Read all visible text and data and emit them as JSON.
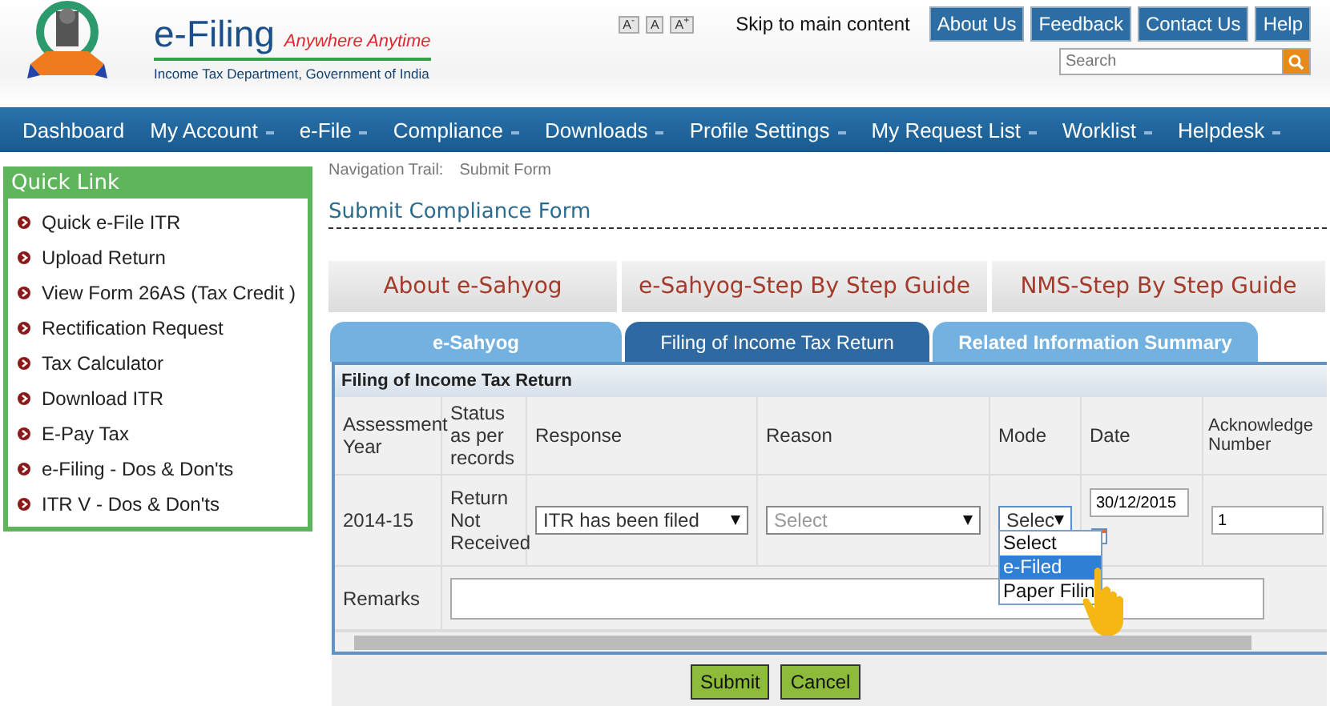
{
  "header": {
    "site_title": "e-Filing",
    "tagline": "Anywhere Anytime",
    "department": "Income Tax Department, Government of India",
    "font_size_buttons": [
      "A$^{-}$",
      "A",
      "A$^{+}$"
    ],
    "skip_link": "Skip to main content",
    "top_links": [
      "About Us",
      "Feedback",
      "Contact Us",
      "Help"
    ],
    "search": {
      "placeholder": "Search"
    }
  },
  "nav": [
    {
      "label": "Dashboard",
      "dropdown": false
    },
    {
      "label": "My Account",
      "dropdown": true
    },
    {
      "label": "e-File",
      "dropdown": true
    },
    {
      "label": "Compliance",
      "dropdown": true
    },
    {
      "label": "Downloads",
      "dropdown": true
    },
    {
      "label": "Profile Settings",
      "dropdown": true
    },
    {
      "label": "My Request List",
      "dropdown": true
    },
    {
      "label": "Worklist",
      "dropdown": true
    },
    {
      "label": "Helpdesk",
      "dropdown": true
    }
  ],
  "quick_link": {
    "title": "Quick Link",
    "items": [
      "Quick e-File ITR",
      "Upload Return",
      "View Form 26AS (Tax Credit )",
      "Rectification Request",
      "Tax Calculator",
      "Download ITR",
      "E-Pay Tax",
      "e-Filing - Dos & Don'ts",
      "ITR V - Dos & Don'ts"
    ]
  },
  "breadcrumb": {
    "label": "Navigation Trail:",
    "current": "Submit Form"
  },
  "page_title": "Submit Compliance Form",
  "guide_buttons": [
    "About e-Sahyog",
    "e-Sahyog-Step By Step Guide",
    "NMS-Step By Step Guide"
  ],
  "tabs": [
    {
      "label": "e-Sahyog",
      "selected": false
    },
    {
      "label": "Filing of Income Tax Return",
      "selected": true
    },
    {
      "label": "Related Information Summary",
      "selected": false
    }
  ],
  "panel": {
    "title": "Filing of Income Tax Return",
    "columns": [
      "Assessment Year",
      "Status as per records",
      "Response",
      "Reason",
      "Mode",
      "Date",
      "Acknowledge Number"
    ],
    "row": {
      "assessment_year": "2014-15",
      "status": "Return Not Received",
      "response": {
        "value": "ITR has been filed"
      },
      "reason": {
        "placeholder": "Select"
      },
      "mode": {
        "value": "Selec",
        "expanded": true,
        "options": [
          {
            "label": "Select",
            "selected": false
          },
          {
            "label": "e-Filed",
            "selected": true
          },
          {
            "label": "Paper Filin",
            "selected": false
          }
        ]
      },
      "date": "30/12/2015",
      "acknowledgement": "1"
    },
    "remarks_label": "Remarks"
  },
  "actions": [
    "Submit",
    "Cancel"
  ]
}
